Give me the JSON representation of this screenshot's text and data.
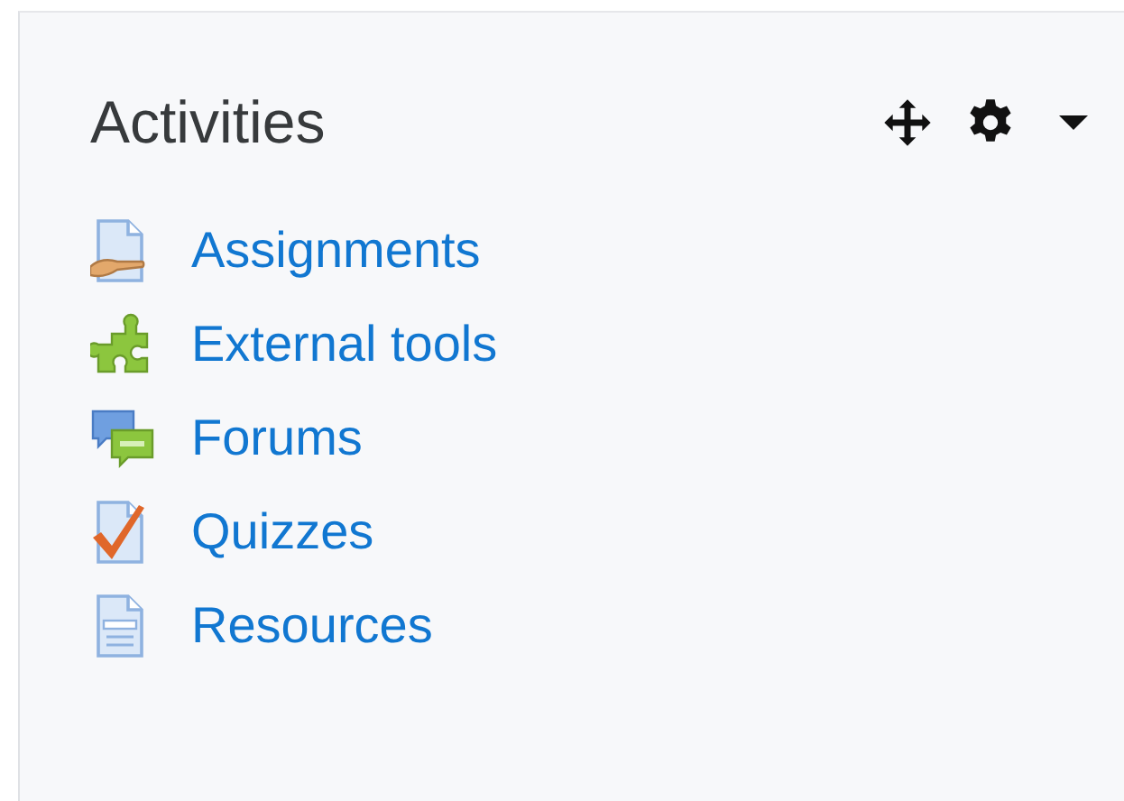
{
  "block": {
    "title": "Activities",
    "items": [
      {
        "label": "Assignments",
        "kind": "assignment"
      },
      {
        "label": "External tools",
        "kind": "tool"
      },
      {
        "label": "Forums",
        "kind": "forum"
      },
      {
        "label": "Quizzes",
        "kind": "quiz"
      },
      {
        "label": "Resources",
        "kind": "resource"
      }
    ]
  }
}
